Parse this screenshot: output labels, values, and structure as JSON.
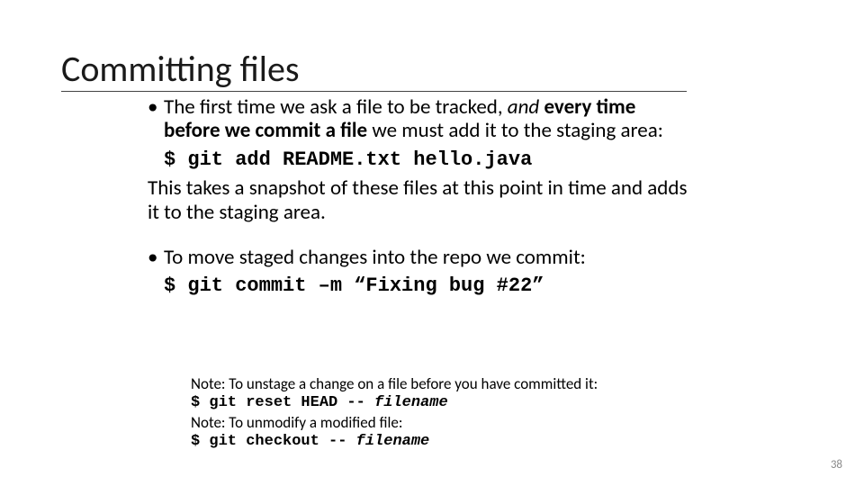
{
  "title": "Committing files",
  "bullet1": {
    "pre": "The first time we ask a file to be tracked, ",
    "and": "and",
    "bold": " every time before we commit a file",
    "post": " we must add it to the staging area:"
  },
  "cmd1": "$ git add README.txt hello.java",
  "followup": "This takes a snapshot of these files at this point in time and adds it to the staging area.",
  "bullet2": "To move staged changes into the repo we commit:",
  "cmd2": "$ git commit –m “Fixing bug #22”",
  "notes": {
    "n1": "Note: To unstage a change on a file before you have committed it:",
    "c1a": "$ git reset HEAD -- ",
    "c1b": "filename",
    "n2": "Note: To unmodify a modified file:",
    "c2a": "$ git checkout -- ",
    "c2b": "filename"
  },
  "page": "38"
}
